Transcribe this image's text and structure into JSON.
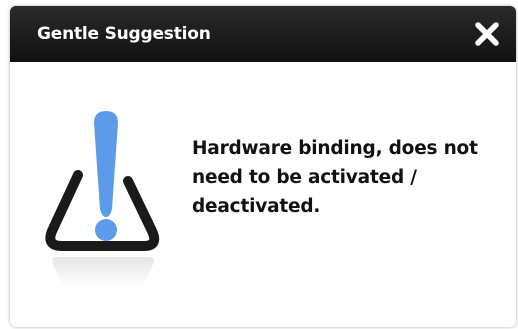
{
  "dialog": {
    "title": "Gentle Suggestion",
    "close_icon": "close-icon",
    "message": "Hardware binding, does not need to be activated / deactivated.",
    "warning_icon": "warning-exclamation-icon",
    "colors": {
      "titlebar": "#1a1a1a",
      "title_text": "#ffffff",
      "accent_blue": "#5b9bea",
      "icon_outline": "#1a1a1a",
      "body_text": "#111111"
    }
  }
}
